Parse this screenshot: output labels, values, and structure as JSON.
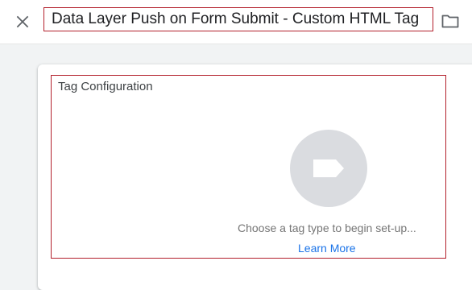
{
  "header": {
    "close_icon": "close-icon",
    "title": "Data Layer Push on Form Submit - Custom HTML Tag",
    "folder_icon": "folder-icon"
  },
  "tag_configuration": {
    "heading": "Tag Configuration",
    "tag_type_icon": "tag-icon",
    "hint": "Choose a tag type to begin set-up...",
    "learn_more": "Learn More"
  },
  "colors": {
    "highlight_border": "#b3202c",
    "link": "#1a73e8",
    "placeholder_circle": "#dadce0",
    "background": "#f1f3f4"
  }
}
